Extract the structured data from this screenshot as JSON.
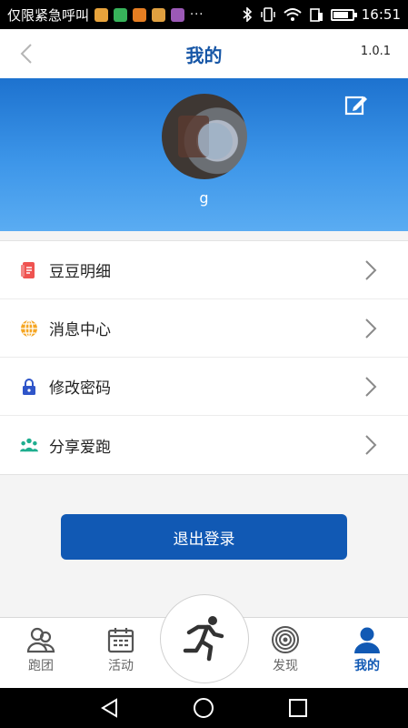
{
  "status_bar": {
    "carrier": "仅限紧急呼叫",
    "more": "···",
    "time": "16:51",
    "app_colors": [
      "#e8a33b",
      "#37b35a",
      "#e67e22",
      "#e0a040",
      "#9b59b6"
    ]
  },
  "header": {
    "title": "我的",
    "version": "1.0.1",
    "back_icon": "chevron-left-icon"
  },
  "profile": {
    "username": "g",
    "edit_icon": "edit-icon"
  },
  "menu": {
    "items": [
      {
        "label": "豆豆明细",
        "icon": "document-icon",
        "color": "#ef5350"
      },
      {
        "label": "消息中心",
        "icon": "globe-icon",
        "color": "#f5a623"
      },
      {
        "label": "修改密码",
        "icon": "lock-icon",
        "color": "#2f55c9"
      },
      {
        "label": "分享爱跑",
        "icon": "people-icon",
        "color": "#1fae8f"
      }
    ]
  },
  "logout": {
    "label": "退出登录"
  },
  "tabbar": {
    "tabs": [
      {
        "label": "跑团",
        "icon": "group-icon"
      },
      {
        "label": "活动",
        "icon": "calendar-icon"
      },
      {
        "label": "",
        "icon": "runner-icon"
      },
      {
        "label": "发现",
        "icon": "target-icon"
      },
      {
        "label": "我的",
        "icon": "user-icon",
        "active": true
      }
    ]
  },
  "colors": {
    "accent": "#1159b4",
    "title": "#1656a6"
  }
}
